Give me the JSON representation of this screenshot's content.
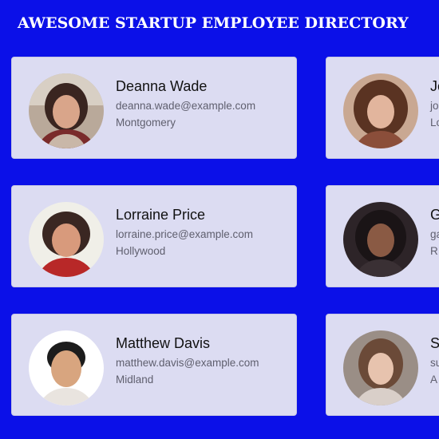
{
  "header": {
    "title": "AWESOME STARTUP EMPLOYEE DIRECTORY"
  },
  "employees": [
    {
      "name": "Deanna Wade",
      "email": "deanna.wade@example.com",
      "city": "Montgomery",
      "avatar": "woman-portrait"
    },
    {
      "name": "Jo",
      "email": "jo",
      "city": "Lo",
      "avatar": "woman-portrait"
    },
    {
      "name": "Lorraine Price",
      "email": "lorraine.price@example.com",
      "city": "Hollywood",
      "avatar": "woman-portrait"
    },
    {
      "name": "G",
      "email": "ga",
      "city": "R",
      "avatar": "woman-portrait"
    },
    {
      "name": "Matthew Davis",
      "email": "matthew.davis@example.com",
      "city": "Midland",
      "avatar": "man-portrait"
    },
    {
      "name": "S",
      "email": "su",
      "city": "A",
      "avatar": "woman-portrait"
    }
  ]
}
